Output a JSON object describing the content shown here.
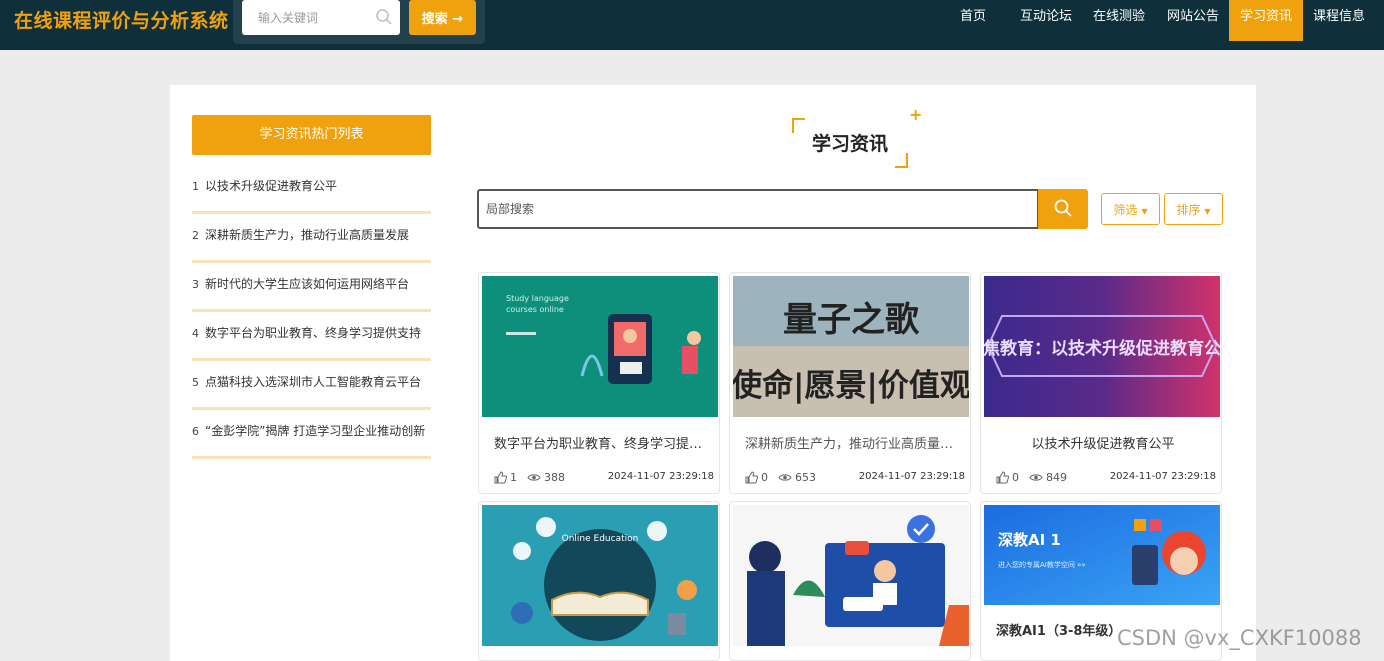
{
  "header": {
    "site_title": "在线课程评价与分析系统",
    "keyword_placeholder": "输入关键词",
    "search_button": "搜索 →"
  },
  "nav": {
    "items": [
      "首页",
      "互动论坛",
      "在线测验",
      "网站公告",
      "学习资讯",
      "课程信息"
    ],
    "active": "学习资讯"
  },
  "sidebar": {
    "header": "学习资讯热门列表",
    "items": [
      {
        "num": "1",
        "text": "以技术升级促进教育公平"
      },
      {
        "num": "2",
        "text": "深耕新质生产力，推动行业高质量发展"
      },
      {
        "num": "3",
        "text": "新时代的大学生应该如何运用网络平台"
      },
      {
        "num": "4",
        "text": "数字平台为职业教育、终身学习提供支持"
      },
      {
        "num": "5",
        "text": "点猫科技入选深圳市人工智能教育云平台"
      },
      {
        "num": "6",
        "text": "“金彭学院”揭牌 打造学习型企业推动创新"
      }
    ]
  },
  "main": {
    "section_title": "学习资讯",
    "local_search_placeholder": "局部搜索",
    "filter_label": "筛选",
    "sort_label": "排序",
    "cards": [
      {
        "title": "数字平台为职业教育、终身学习提供支持",
        "likes": "1",
        "views": "388",
        "time": "2024-11-07 23:29:18",
        "thumb_text": [
          "Study language",
          "courses online"
        ]
      },
      {
        "title": "深耕新质生产力，推动行业高质量发展",
        "likes": "0",
        "views": "653",
        "time": "2024-11-07 23:29:18",
        "thumb_text": [
          "量子之歌",
          "使命|愿景|价值观"
        ]
      },
      {
        "title": "以技术升级促进教育公平",
        "likes": "0",
        "views": "849",
        "time": "2024-11-07 23:29:18",
        "thumb_text": [
          "聚焦教育：以技术升级促进教育公平"
        ]
      },
      {
        "title": "",
        "likes": "",
        "views": "",
        "time": "",
        "thumb_text": [
          "Online Education"
        ]
      },
      {
        "title": "",
        "likes": "",
        "views": "",
        "time": "",
        "thumb_text": []
      },
      {
        "title": "深教AI1（3-8年级）",
        "likes": "",
        "views": "",
        "time": "",
        "thumb_text": [
          "深教AI 1",
          "进入您的专属AI教学空间 »»"
        ]
      }
    ]
  },
  "watermark": "CSDN @vx_CXKF10088",
  "colors": {
    "accent": "#f0a20e",
    "topbar": "#0f2f3b"
  }
}
